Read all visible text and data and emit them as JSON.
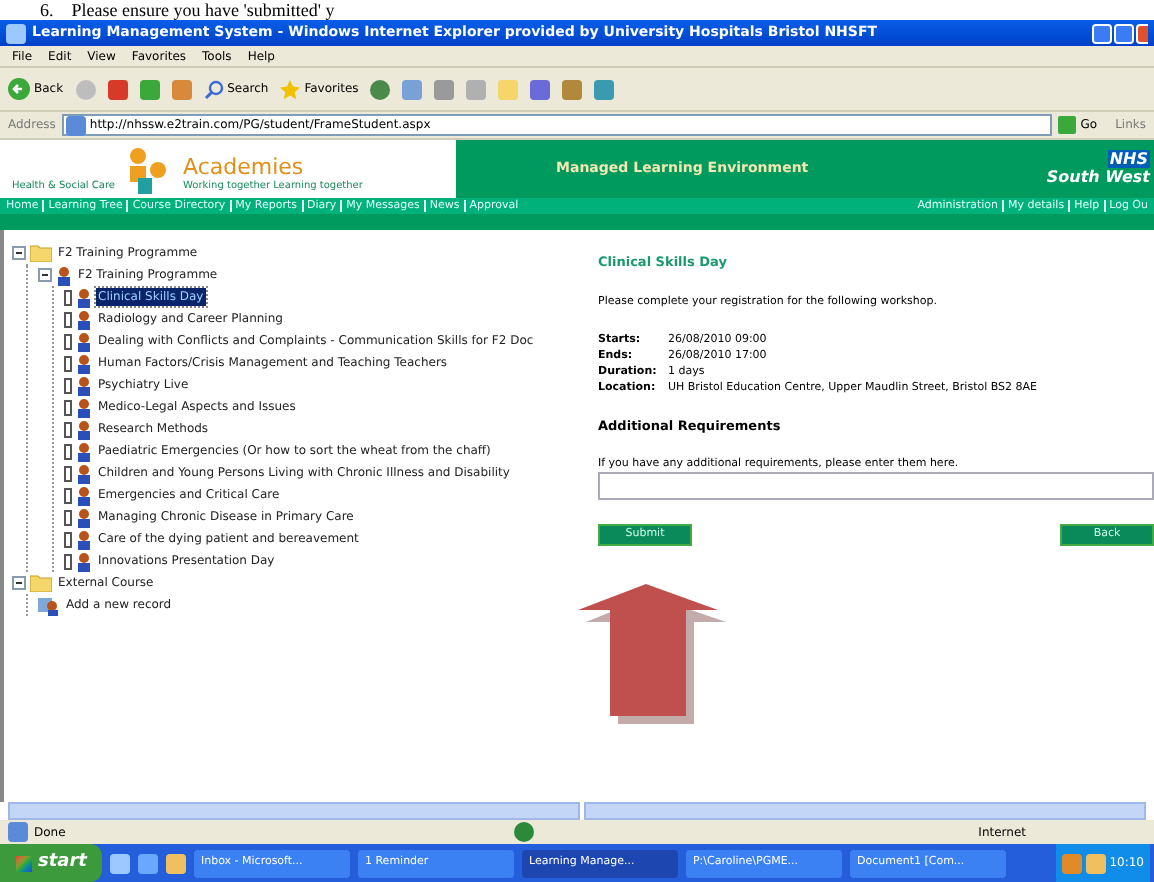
{
  "document_text": "6.    Please ensure you have 'submitted' y",
  "window": {
    "title": "Learning Management System - Windows Internet Explorer provided by University Hospitals Bristol NHSFT"
  },
  "menu": [
    "File",
    "Edit",
    "View",
    "Favorites",
    "Tools",
    "Help"
  ],
  "toolbar": {
    "back": "Back",
    "search": "Search",
    "favorites": "Favorites"
  },
  "address": {
    "label": "Address",
    "value": "http://nhssw.e2train.com/PG/student/FrameStudent.aspx",
    "go": "Go",
    "links": "Links"
  },
  "header": {
    "brand": "Academies",
    "tagline": "Working together Learning together",
    "org": "Health & Social Care",
    "title": "Managed Learning Environment",
    "nhs": "NHS",
    "region": "South West"
  },
  "nav_left": [
    "Home",
    "Learning Tree",
    "Course Directory",
    "My Reports",
    "Diary",
    "My Messages",
    "News",
    "Approval"
  ],
  "nav_right": [
    "Administration",
    "My details",
    "Help",
    "Log Ou"
  ],
  "tree": [
    {
      "label": "F2 Training Programme",
      "kind": "folder",
      "expanded": true,
      "selected": false,
      "children": [
        {
          "label": "F2 Training Programme",
          "kind": "programme",
          "expanded": true,
          "selected": false,
          "children": [
            {
              "label": "Clinical Skills Day",
              "kind": "course",
              "selected": true,
              "checked": false
            },
            {
              "label": "Radiology and Career Planning",
              "kind": "course",
              "selected": false,
              "checked": false
            },
            {
              "label": "Dealing with Conflicts and Complaints - Communication Skills for F2 Doc",
              "kind": "course",
              "selected": false,
              "checked": false
            },
            {
              "label": "Human Factors/Crisis Management and Teaching Teachers",
              "kind": "course",
              "selected": false,
              "checked": false
            },
            {
              "label": "Psychiatry Live",
              "kind": "course",
              "selected": false,
              "checked": false
            },
            {
              "label": "Medico-Legal Aspects and Issues",
              "kind": "course",
              "selected": false,
              "checked": false
            },
            {
              "label": "Research Methods",
              "kind": "course",
              "selected": false,
              "checked": false
            },
            {
              "label": "Paediatric Emergencies (Or how to sort the wheat from the chaff)",
              "kind": "course",
              "selected": false,
              "checked": false
            },
            {
              "label": "Children and Young Persons Living with Chronic Illness and Disability",
              "kind": "course",
              "selected": false,
              "checked": false
            },
            {
              "label": "Emergencies and Critical Care",
              "kind": "course",
              "selected": false,
              "checked": false
            },
            {
              "label": "Managing Chronic Disease in Primary Care",
              "kind": "course",
              "selected": false,
              "checked": false
            },
            {
              "label": "Care of the dying patient and bereavement",
              "kind": "course",
              "selected": false,
              "checked": false
            },
            {
              "label": "Innovations Presentation Day",
              "kind": "course",
              "selected": false,
              "checked": false
            }
          ]
        }
      ]
    },
    {
      "label": "External Course",
      "kind": "folder",
      "expanded": true,
      "selected": false,
      "children": [
        {
          "label": "Add a new record",
          "kind": "record",
          "selected": false
        }
      ]
    }
  ],
  "detail": {
    "title": "Clinical Skills Day",
    "intro": "Please complete your registration for the following workshop.",
    "fields": [
      {
        "label": "Starts:",
        "value": "26/08/2010 09:00"
      },
      {
        "label": "Ends:",
        "value": "26/08/2010 17:00"
      },
      {
        "label": "Duration:",
        "value": "1 days"
      },
      {
        "label": "Location:",
        "value": "UH Bristol Education Centre, Upper Maudlin Street, Bristol BS2 8AE"
      }
    ],
    "section": "Additional Requirements",
    "hint": "If you have any additional requirements, please enter them here.",
    "submit": "Submit",
    "back": "Back"
  },
  "status": {
    "text": "Done",
    "zone": "Internet"
  },
  "taskbar": {
    "start": "start",
    "tasks": [
      {
        "label": "Inbox - Microsoft...",
        "selected": false
      },
      {
        "label": "1 Reminder",
        "selected": false
      },
      {
        "label": "Learning Manage...",
        "selected": true
      },
      {
        "label": "P:\\Caroline\\PGME...",
        "selected": false
      },
      {
        "label": "Document1 [Com...",
        "selected": false
      }
    ],
    "clock": "10:10"
  }
}
